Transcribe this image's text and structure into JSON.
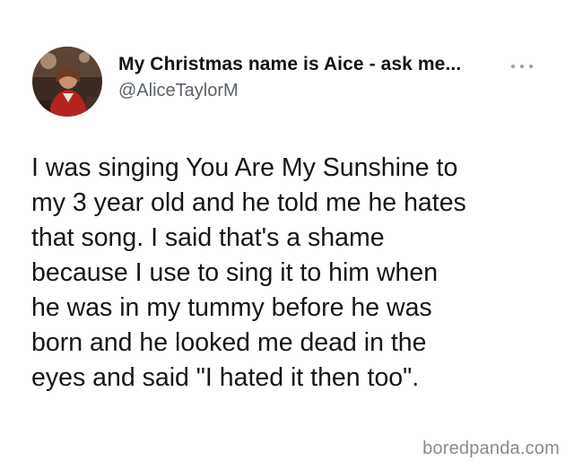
{
  "tweet": {
    "display_name": "My Christmas name is Aice - ask me...",
    "handle": "@AliceTaylorM",
    "more_icon": "more-horizontal-icon",
    "text": "I was singing You Are My Sunshine to\nmy 3 year old and he told me he hates\nthat song. I said that's a shame\nbecause I use to sing it to him when\nhe was in my tummy before he was\nborn and he looked me dead in the\neyes and said \"I hated it then too\"."
  },
  "watermark": {
    "text": "boredpanda.com"
  },
  "colors": {
    "background": "#ffffff",
    "text": "#161616",
    "handle": "#5b6268",
    "watermark": "#8a8a8a"
  }
}
